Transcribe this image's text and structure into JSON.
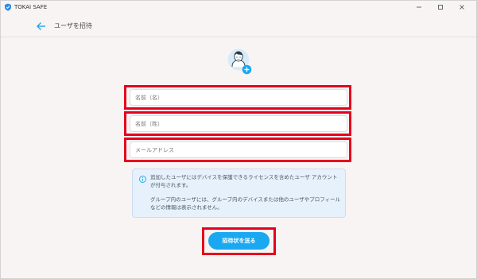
{
  "window": {
    "app_title": "TOKAI SAFE"
  },
  "header": {
    "title": "ユーザを招待"
  },
  "form": {
    "first_name_placeholder": "名前（名）",
    "last_name_placeholder": "名前（姓）",
    "email_placeholder": "メールアドレス"
  },
  "info": {
    "paragraph1": "追加したユーザにはデバイスを保護できるライセンスを含めたユーザ アカウントが付与されます。",
    "paragraph2": "グループ内のユーザには、グループ内のデバイスまたは他のユーザやプロフィールなどの情報は表示されません。"
  },
  "actions": {
    "submit_label": "招待状を送る"
  },
  "colors": {
    "accent": "#1aa8f0",
    "highlight": "#e6001e",
    "info_background": "#e6f1fb",
    "window_background": "#f8f4f4"
  },
  "icons": {
    "app_logo": "shield-icon",
    "back": "arrow-left-icon",
    "avatar": "user-add-icon",
    "info": "info-circle-icon"
  }
}
